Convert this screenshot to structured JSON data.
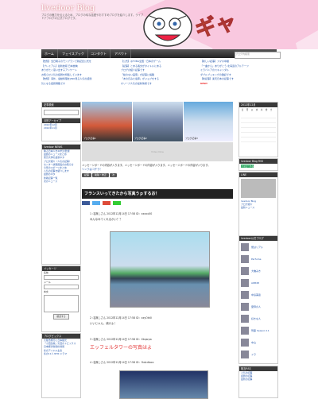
{
  "header": {
    "title": "livedoor Blog",
    "description": "ブログの魅力を伝えるため、ブログの旬な話題やおすすめブログを紹介します。ライブドアブログの公式ブログです。",
    "mascot_text": "ギャ",
    "search_placeholder": "ブログ内検索"
  },
  "nav": {
    "items": [
      "ホーム",
      "フェイスブック",
      "コンタクト",
      "アバウト"
    ]
  },
  "ticker": {
    "col1": [
      "【告知】当日曜子のモンブランで新記念公式を",
      "【プレミアム】最新技報 日本放映",
      "ありがたく思い出す子アンケート",
      "お知らせ人気の話題を特集しています",
      "【告知】海外、電動料理をJINO見る人気の話題",
      "気になる話題満載です"
    ],
    "col2": [
      "【公式】@TVBA全国・日本のゲーム",
      "【記事】とある長文がタイトルにある",
      "ブログの紹介記事です",
      "「絵のない画家」が記事に掲載",
      "「あの日みた電車」がジョブをする",
      "オリーブ人気の最新情報です"
    ],
    "col3": [
      "【新しい記事】スマホ中継",
      "「一曲から」ありがとう 北海道のアルテーツ",
      "ミラバニアのスキャンダル",
      "ダブルブッキングの雑記です",
      "【新記事】楽天日本の記事です"
    ],
    "new_label": "NEW!"
  },
  "left_sidebar": {
    "recent_title": "記事検索",
    "archive_title": "月別アーカイブ",
    "archive_items": [
      "2012年12月",
      "2012年11月"
    ],
    "news_title": "livedoor NEWS",
    "news_items": [
      "降る日本人を20代の監督",
      "話題のニュースまとめ",
      "東京大学の最新ネタ",
      "ブログ紹介（人気の記事）",
      "センター試験延長のお知らせ",
      "今年のスポーツまとめ",
      "人気の記事を紹介します",
      "話題のネタ",
      "新着記事一覧",
      "次のニュース"
    ],
    "message_title": "メッセージ",
    "message_labels": [
      "名前",
      "メール",
      "本文"
    ],
    "submit_label": "確認する",
    "topics_title": "ブログピックス",
    "topics_items": [
      "大阪市旅行に日本観光",
      "「小田急線」気温のトピックス",
      "日本経済新聞の情報",
      "冬のアイドル主演",
      "冬の11人 NHK ドラマ"
    ]
  },
  "slides": [
    "ブログ記事1",
    "ブログ記事2",
    "ブログ記事3"
  ],
  "mini_ad": "Video Now",
  "message_board": {
    "text": "メッセージボードの内容が入ります。メッセージボードの内容が入ります。メッセージボードの内容が入ります。",
    "link": "リンクはコチラ！",
    "buttons": [
      "記事",
      "削除・修正",
      "次"
    ]
  },
  "post": {
    "title": "フランスいってきたから写真うｐするお！",
    "meta1": "1 :名無しさん 2012年12月14日 17:58 ID：xxxxxX0",
    "body1": "みんなみてくれるかい？？",
    "meta2": "2 :名無しさん 2012年12月14日 17:58 ID：xxyOkt0",
    "body2": "いいじゃん、続けよ！",
    "meta3": "3 :名無しさん 2012年12月14日 17:58 ID：Xkqsrpa",
    "body3": "エッフェルタワーの写真はよ",
    "meta4": "4 :名無しさん 2012年12月14日 17:58 ID：fhdcdtaco"
  },
  "right_sidebar": {
    "calendar_title": "2012年12月",
    "weekdays": [
      "日",
      "月",
      "火",
      "水",
      "木",
      "金",
      "土"
    ],
    "rss_title": "livedoor Blog RSS",
    "follow_label": "フォローする",
    "links_title": "LINE",
    "link_items": [
      "livedoor Blog",
      "ブログ紹介",
      "最新ニュース"
    ],
    "members_title": "livedoor公式ブログ",
    "members": [
      "僕はリアル",
      "Parfume",
      "大橋みき",
      "AKB48",
      "中島美嘉",
      "愛称の人",
      "好きな人",
      "刑事 Season 11",
      "中山",
      "ドラ"
    ],
    "related_title": "相互RSS",
    "related_items": [
      "人気の記事",
      "話題の記事",
      "最新の記事"
    ]
  },
  "colors": {
    "header_bg": "#fbe3ef",
    "nav_bg": "#333333",
    "link": "#2255aa",
    "accent": "#f58220",
    "red_text": "#e33333"
  }
}
